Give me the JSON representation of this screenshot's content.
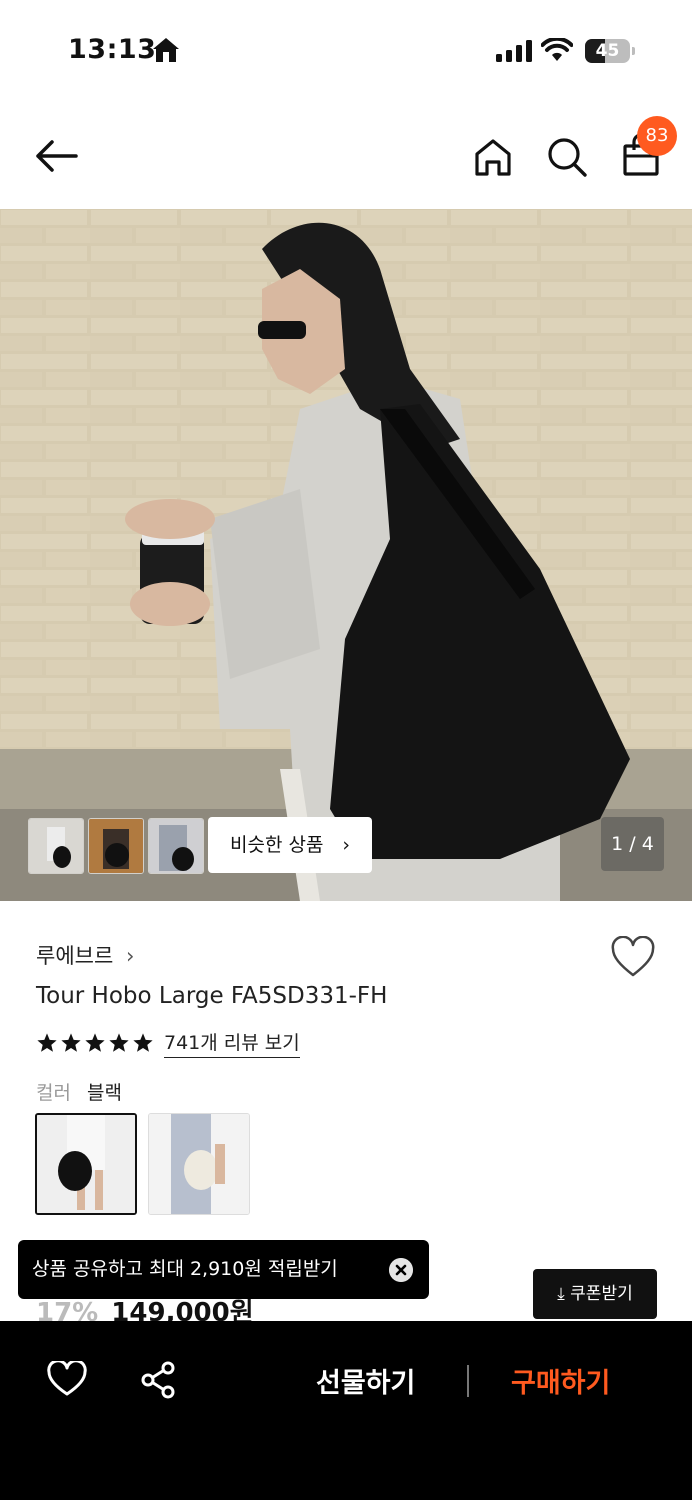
{
  "status_bar": {
    "time": "13:13",
    "battery": "45",
    "battery_level": 0.45
  },
  "header": {
    "cart_count": "83"
  },
  "hero": {
    "page_indicator": "1 / 4",
    "similar_label": "비슷한 상품"
  },
  "product": {
    "brand": "루에브르",
    "title": "Tour Hobo Large FA5SD331-FH",
    "rating_stars": 5,
    "review_link": "741개 리뷰 보기",
    "color_label": "컬러",
    "color_value": "블랙",
    "price": {
      "discount": "17%",
      "amount": "149,000원"
    }
  },
  "toast": {
    "text": "상품 공유하고 최대 2,910원 적립받기"
  },
  "coupon": {
    "label": "쿠폰받기"
  },
  "bottom_bar": {
    "gift": "선물하기",
    "buy": "구매하기"
  },
  "colors": {
    "accent": "#ff5a1f",
    "dark": "#000000"
  }
}
